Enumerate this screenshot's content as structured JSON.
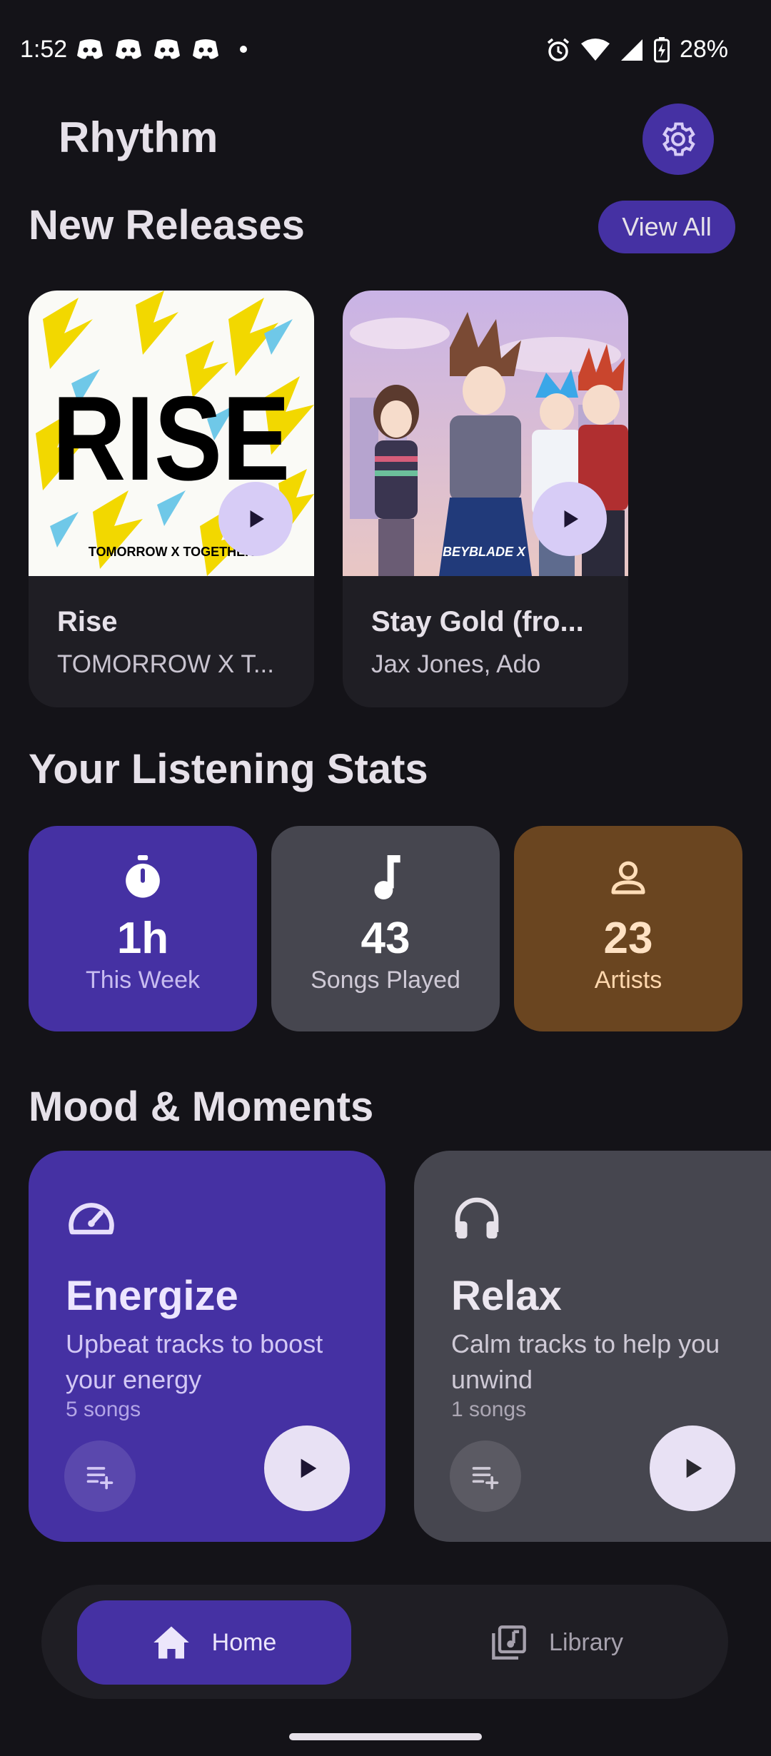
{
  "status_bar": {
    "time": "1:52",
    "battery": "28%",
    "notification_icons": [
      "discord-icon",
      "discord-icon",
      "discord-icon",
      "discord-icon"
    ]
  },
  "header": {
    "title": "Rhythm",
    "settings_icon": "gear-icon"
  },
  "new_releases": {
    "title": "New Releases",
    "view_all_label": "View All",
    "items": [
      {
        "title": "Rise",
        "artist": "TOMORROW X T...",
        "art_text": "RISE",
        "art_caption": "TOMORROW X TOGETHER"
      },
      {
        "title": "Stay Gold (fro...",
        "artist": "Jax Jones, Ado",
        "art_caption": "BEYBLADE X"
      }
    ]
  },
  "stats": {
    "title": "Your Listening Stats",
    "items": [
      {
        "value": "1h",
        "label": "This Week",
        "icon": "timer-icon"
      },
      {
        "value": "43",
        "label": "Songs Played",
        "icon": "music-note-icon"
      },
      {
        "value": "23",
        "label": "Artists",
        "icon": "person-icon"
      }
    ]
  },
  "mood": {
    "title": "Mood & Moments",
    "items": [
      {
        "title": "Energize",
        "description": "Upbeat tracks to boost your energy",
        "count": "5 songs",
        "icon": "speedometer-icon"
      },
      {
        "title": "Relax",
        "description": "Calm tracks to help you unwind",
        "count": "1 songs",
        "icon": "headphones-icon"
      }
    ]
  },
  "nav": {
    "home_label": "Home",
    "library_label": "Library"
  },
  "colors": {
    "background": "#141318",
    "accent": "#4531a3",
    "card": "#1f1e24",
    "stat_gray": "#46464f",
    "stat_brown": "#6a4520"
  }
}
